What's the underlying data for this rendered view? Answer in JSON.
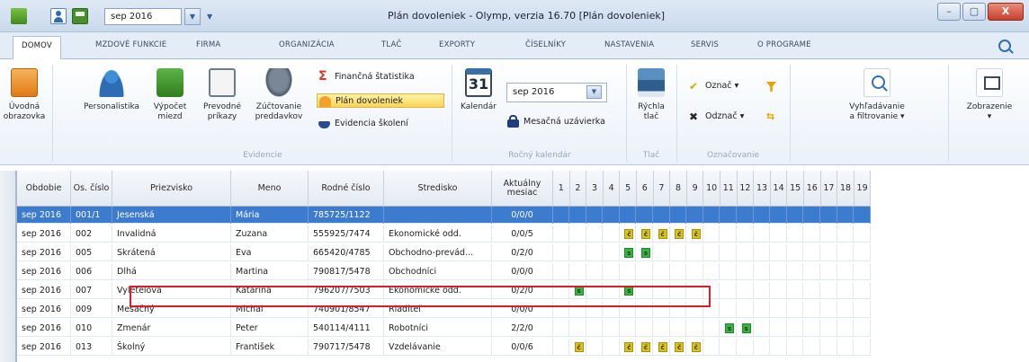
{
  "titlebar": {
    "period": "sep 2016",
    "title": "Plán dovoleniek - Olymp, verzia 16.70 [Plán dovoleniek]",
    "btn_min": "–",
    "btn_max": "▢",
    "btn_close": "X"
  },
  "tabs": [
    "DOMOV",
    "MZDOVÉ FUNKCIE",
    "FIRMA",
    "ORGANIZÁCIA",
    "TLAČ",
    "EXPORTY",
    "ČÍSELNÍKY",
    "NASTAVENIA",
    "SERVIS",
    "O PROGRAME"
  ],
  "ribbon": {
    "home": "Úvodná\nobrazovka",
    "personalistika": "Personalistika",
    "vypocet": "Výpočet\nmiezd",
    "prevodne": "Prevodné\npríkazy",
    "zuctovanie": "Zúčtovanie\npreddavkov",
    "financna": "Finančná štatistika",
    "plan": "Plán dovoleniek",
    "evidencia_skoleni": "Evidencia školení",
    "group_evidencie": "Evidencie",
    "kalendar": "Kalendár",
    "kalendar_day": "31",
    "period_select": "sep 2016",
    "mesacna": "Mesačná uzávierka",
    "group_rocny": "Ročný kalendár",
    "rychla": "Rýchla\ntlač",
    "group_tlac": "Tlač",
    "oznac": "Označ ▾",
    "odznac": "Odznač ▾",
    "group_oznacovanie": "Označovanie",
    "vyhladavanie": "Vyhľadávanie\na filtrovanie ▾",
    "zobrazenie": "Zobrazenie\n▾"
  },
  "grid": {
    "headers": [
      "Obdobie",
      "Os. číslo",
      "Priezvisko",
      "Meno",
      "Rodné číslo",
      "Stredisko",
      "Aktuálny\nmesiac"
    ],
    "days": [
      "1",
      "2",
      "3",
      "4",
      "5",
      "6",
      "7",
      "8",
      "9",
      "10",
      "11",
      "12",
      "13",
      "14",
      "15",
      "16",
      "17",
      "18",
      "19"
    ],
    "rows": [
      {
        "obdobie": "sep 2016",
        "os": "001/1",
        "priezvisko": "Jesenská",
        "meno": "Mária",
        "rc": "785725/1122",
        "stredisko": "",
        "mesiac": "0/0/0",
        "marks": {}
      },
      {
        "obdobie": "sep 2016",
        "os": "002",
        "priezvisko": "Invalidná",
        "meno": "Zuzana",
        "rc": "555925/7474",
        "stredisko": "Ekonomické odd.",
        "mesiac": "0/0/5",
        "marks": {
          "5": "č",
          "6": "č",
          "7": "č",
          "8": "č",
          "9": "č"
        }
      },
      {
        "obdobie": "sep 2016",
        "os": "005",
        "priezvisko": "Skrátená",
        "meno": "Eva",
        "rc": "665420/4785",
        "stredisko": "Obchodno-prevád...",
        "mesiac": "0/2/0",
        "marks": {
          "5": "s",
          "6": "s"
        }
      },
      {
        "obdobie": "sep 2016",
        "os": "006",
        "priezvisko": "Dlhá",
        "meno": "Martina",
        "rc": "790817/5478",
        "stredisko": "Obchodníci",
        "mesiac": "0/0/0",
        "marks": {}
      },
      {
        "obdobie": "sep 2016",
        "os": "007",
        "priezvisko": "Vyletelová",
        "meno": "Katarína",
        "rc": "796207/7503",
        "stredisko": "Ekonomické odd.",
        "mesiac": "0/2/0",
        "marks": {
          "2": "s",
          "5": "s"
        }
      },
      {
        "obdobie": "sep 2016",
        "os": "009",
        "priezvisko": "Mesačný",
        "meno": "Michal",
        "rc": "740901/8547",
        "stredisko": "Riaditeľ",
        "mesiac": "0/0/0",
        "marks": {}
      },
      {
        "obdobie": "sep 2016",
        "os": "010",
        "priezvisko": "Zmenár",
        "meno": "Peter",
        "rc": "540114/4111",
        "stredisko": "Robotníci",
        "mesiac": "2/2/0",
        "marks": {
          "11": "s",
          "12": "s"
        }
      },
      {
        "obdobie": "sep 2016",
        "os": "013",
        "priezvisko": "Školný",
        "meno": "František",
        "rc": "790717/5478",
        "stredisko": "Vzdelávanie",
        "mesiac": "0/0/6",
        "marks": {
          "2": "č",
          "5": "č",
          "6": "č",
          "7": "č",
          "8": "č",
          "9": "č"
        }
      }
    ]
  },
  "colors": {
    "selected_row": "#3d7bcf",
    "mark_c": "#d8c21c",
    "mark_s": "#3cb043",
    "highlight": "#d8202a"
  }
}
